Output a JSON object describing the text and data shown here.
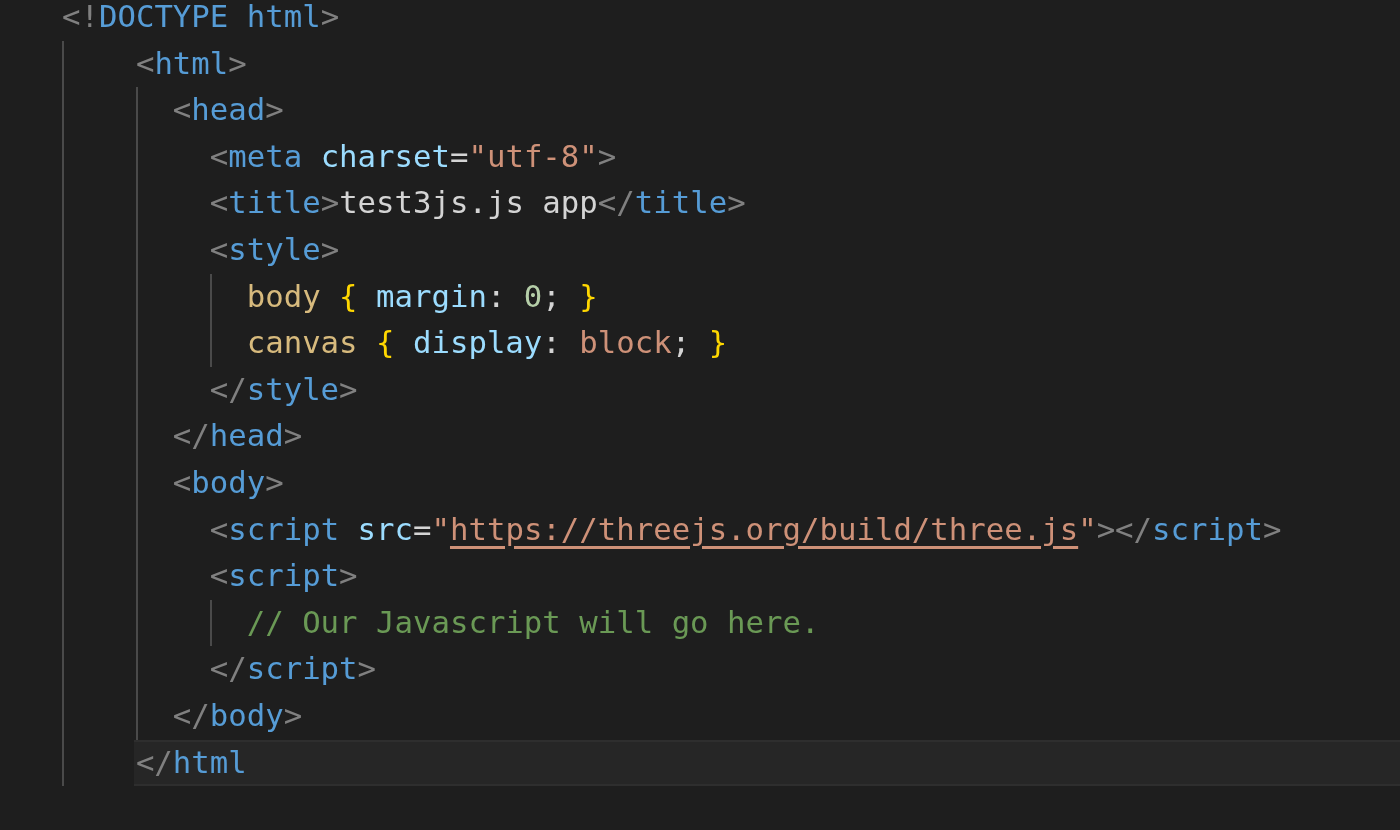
{
  "editor": {
    "lines": [
      {
        "current": false,
        "guide": true,
        "tokens": [
          {
            "kind": "punct",
            "text": "<!"
          },
          {
            "kind": "tag",
            "text": "DOCTYPE html"
          },
          {
            "kind": "punct",
            "text": ">"
          }
        ],
        "children": [
          {
            "current": false,
            "guide": true,
            "tokens": [
              {
                "kind": "punct",
                "text": "<"
              },
              {
                "kind": "tag",
                "text": "html"
              },
              {
                "kind": "punct",
                "text": ">"
              }
            ],
            "children": [
              {
                "current": false,
                "guide": false,
                "tokens": [
                  {
                    "kind": "punct",
                    "text": "<"
                  },
                  {
                    "kind": "tag",
                    "text": "head"
                  },
                  {
                    "kind": "punct",
                    "text": ">"
                  }
                ],
                "children": [
                  {
                    "current": false,
                    "tokens": [
                      {
                        "kind": "punct",
                        "text": "<"
                      },
                      {
                        "kind": "tag",
                        "text": "meta"
                      },
                      {
                        "kind": "attr",
                        "text": " charset"
                      },
                      {
                        "kind": "text",
                        "text": "="
                      },
                      {
                        "kind": "string",
                        "text": "\"utf-8\""
                      },
                      {
                        "kind": "punct",
                        "text": ">"
                      }
                    ]
                  },
                  {
                    "current": false,
                    "tokens": [
                      {
                        "kind": "punct",
                        "text": "<"
                      },
                      {
                        "kind": "tag",
                        "text": "title"
                      },
                      {
                        "kind": "punct",
                        "text": ">"
                      },
                      {
                        "kind": "text",
                        "text": "test3js.js app"
                      },
                      {
                        "kind": "punct",
                        "text": "</"
                      },
                      {
                        "kind": "tag",
                        "text": "title"
                      },
                      {
                        "kind": "punct",
                        "text": ">"
                      }
                    ]
                  },
                  {
                    "current": false,
                    "guide": true,
                    "tokens": [
                      {
                        "kind": "punct",
                        "text": "<"
                      },
                      {
                        "kind": "tag",
                        "text": "style"
                      },
                      {
                        "kind": "punct",
                        "text": ">"
                      }
                    ],
                    "children": [
                      {
                        "current": false,
                        "tokens": [
                          {
                            "kind": "selector",
                            "text": "body"
                          },
                          {
                            "kind": "brace",
                            "text": " {"
                          },
                          {
                            "kind": "property",
                            "text": " margin"
                          },
                          {
                            "kind": "text",
                            "text": ": "
                          },
                          {
                            "kind": "number",
                            "text": "0"
                          },
                          {
                            "kind": "text",
                            "text": "; "
                          },
                          {
                            "kind": "brace",
                            "text": "}"
                          }
                        ]
                      },
                      {
                        "current": false,
                        "tokens": [
                          {
                            "kind": "selector",
                            "text": "canvas"
                          },
                          {
                            "kind": "brace",
                            "text": " {"
                          },
                          {
                            "kind": "property",
                            "text": " display"
                          },
                          {
                            "kind": "text",
                            "text": ": "
                          },
                          {
                            "kind": "value",
                            "text": "block"
                          },
                          {
                            "kind": "text",
                            "text": "; "
                          },
                          {
                            "kind": "brace",
                            "text": "}"
                          }
                        ]
                      }
                    ]
                  },
                  {
                    "current": false,
                    "tokens": [
                      {
                        "kind": "punct",
                        "text": "</"
                      },
                      {
                        "kind": "tag",
                        "text": "style"
                      },
                      {
                        "kind": "punct",
                        "text": ">"
                      }
                    ]
                  }
                ]
              },
              {
                "current": false,
                "tokens": [
                  {
                    "kind": "punct",
                    "text": "</"
                  },
                  {
                    "kind": "tag",
                    "text": "head"
                  },
                  {
                    "kind": "punct",
                    "text": ">"
                  }
                ]
              },
              {
                "current": false,
                "guide": false,
                "tokens": [
                  {
                    "kind": "punct",
                    "text": "<"
                  },
                  {
                    "kind": "tag",
                    "text": "body"
                  },
                  {
                    "kind": "punct",
                    "text": ">"
                  }
                ],
                "children": [
                  {
                    "current": false,
                    "tokens": [
                      {
                        "kind": "punct",
                        "text": "<"
                      },
                      {
                        "kind": "tag",
                        "text": "script"
                      },
                      {
                        "kind": "attr",
                        "text": " src"
                      },
                      {
                        "kind": "text",
                        "text": "="
                      },
                      {
                        "kind": "string",
                        "text": "\""
                      },
                      {
                        "kind": "link",
                        "text": "https://threejs.org/build/three.js"
                      },
                      {
                        "kind": "string",
                        "text": "\""
                      },
                      {
                        "kind": "punct",
                        "text": "></"
                      },
                      {
                        "kind": "tag",
                        "text": "script"
                      },
                      {
                        "kind": "punct",
                        "text": ">"
                      }
                    ]
                  },
                  {
                    "current": false,
                    "guide": true,
                    "tokens": [
                      {
                        "kind": "punct",
                        "text": "<"
                      },
                      {
                        "kind": "tag",
                        "text": "script"
                      },
                      {
                        "kind": "punct",
                        "text": ">"
                      }
                    ],
                    "children": [
                      {
                        "current": false,
                        "tokens": [
                          {
                            "kind": "comment",
                            "text": "// Our Javascript will go here."
                          }
                        ]
                      }
                    ]
                  },
                  {
                    "current": false,
                    "tokens": [
                      {
                        "kind": "punct",
                        "text": "</"
                      },
                      {
                        "kind": "tag",
                        "text": "script"
                      },
                      {
                        "kind": "punct",
                        "text": ">"
                      }
                    ]
                  }
                ]
              },
              {
                "current": false,
                "tokens": [
                  {
                    "kind": "punct",
                    "text": "</"
                  },
                  {
                    "kind": "tag",
                    "text": "body"
                  },
                  {
                    "kind": "punct",
                    "text": ">"
                  }
                ]
              }
            ]
          },
          {
            "current": true,
            "tokens": [
              {
                "kind": "punct",
                "text": "</"
              },
              {
                "kind": "tag",
                "text": "html"
              }
            ]
          }
        ]
      }
    ]
  }
}
